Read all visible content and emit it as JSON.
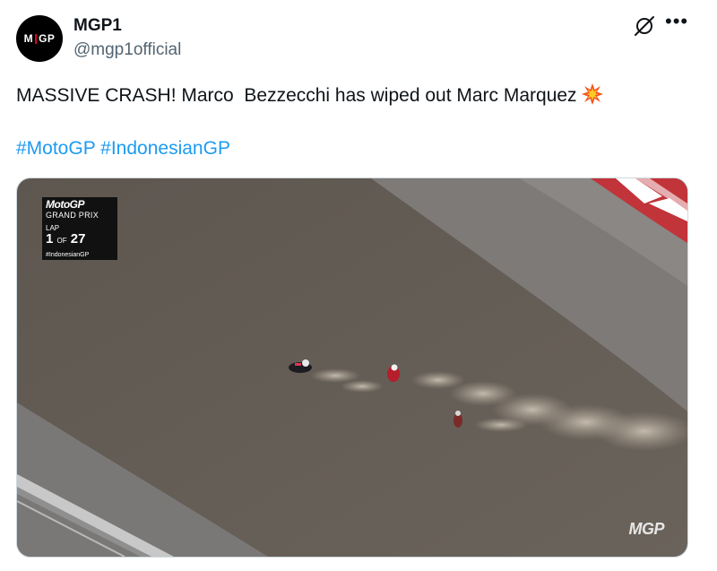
{
  "author": {
    "avatar_text": "MGP",
    "display_name": "MGP1",
    "handle": "@mgp1official"
  },
  "tweet": {
    "text": "MASSIVE CRASH! Marco  Bezzecchi has wiped out Marc Marquez",
    "emoji": "collision-emoji",
    "hashtags": [
      "#MotoGP",
      "#IndonesianGP"
    ]
  },
  "icons": [
    "grok-icon",
    "more-options-icon",
    "collision-emoji"
  ],
  "media": {
    "overlay": {
      "brand": "MotoGP",
      "series": "GRAND PRIX",
      "lap_label": "LAP",
      "lap_current": "1",
      "lap_of": "OF",
      "lap_total": "27",
      "event_tag": "#IndonesianGP"
    },
    "watermark": "MGP"
  }
}
